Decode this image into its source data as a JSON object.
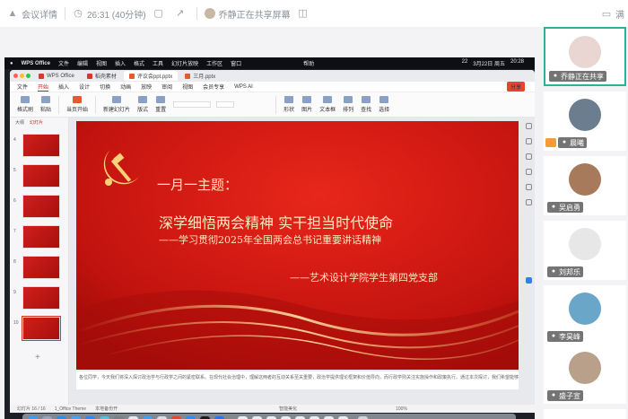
{
  "topbar": {
    "meeting_details": "会议详情",
    "timer": "26:31 (40分钟)",
    "sharing_status": "乔静正在共享屏幕",
    "right_label": "满"
  },
  "mac": {
    "menubar": [
      "WPS Office",
      "文件",
      "编辑",
      "视图",
      "插入",
      "格式",
      "工具",
      "幻灯片放映",
      "工作区",
      "窗口",
      "帮助"
    ],
    "status_right": [
      "22",
      "3月22日 周五",
      "20:28"
    ]
  },
  "wps": {
    "tabs": [
      {
        "label": "WPS Office",
        "color": "#d63a2b"
      },
      {
        "label": "稻壳素材",
        "color": "#d63a2b"
      },
      {
        "label": "评议会ppt.pptx",
        "color": "#e55b2d"
      },
      {
        "label": "三月.pptx",
        "color": "#e55b2d"
      }
    ],
    "menu": [
      "文件",
      "开始",
      "插入",
      "设计",
      "切换",
      "动画",
      "放映",
      "审阅",
      "视图",
      "会员专享",
      "WPS AI"
    ],
    "share_label": "分享",
    "ribbon": [
      "格式刷",
      "粘贴",
      "当页开始",
      "新建幻灯片",
      "版式",
      "重置",
      "形状",
      "图片",
      "文本框",
      "排列",
      "查找",
      "选择"
    ],
    "panel_tabs": [
      "大纲",
      "幻灯片"
    ],
    "slide_numbers": [
      "4",
      "5",
      "6",
      "7",
      "8",
      "9",
      "10"
    ],
    "notes_text": "各位同学，今天我们将深入探讨政治学与行政学之间的紧密联系。在现代社会治理中，理解这两者的互动关系至关重要，政治学提供理论框架和价值导向，而行政学则关注实施操作和政策执行。通过本次探讨，我们希望能够建立更加系统化的知识体系。",
    "status": [
      "幻灯片 16 / 16",
      "1_Office Theme",
      "本地备份开",
      "智能美化",
      "100%"
    ]
  },
  "slide": {
    "heading": "一月一主题：",
    "main_title": "深学细悟两会精神  实干担当时代使命",
    "subtitle": "——学习贯彻2025年全国两会总书记重要讲话精神",
    "organization": "——艺术设计学院学生第四党支部"
  },
  "participants": [
    {
      "name": "乔静正在共享",
      "speaking": true,
      "host": false,
      "avatar_color": "#e9d6d2"
    },
    {
      "name": "晨曦",
      "speaking": false,
      "host": true,
      "avatar_color": "#6a7e8f"
    },
    {
      "name": "吴启勇",
      "speaking": false,
      "host": false,
      "avatar_color": "#a87a5c"
    },
    {
      "name": "刘邦乐",
      "speaking": false,
      "host": false,
      "avatar_color": "#e7e7e7"
    },
    {
      "name": "李昊峰",
      "speaking": false,
      "host": false,
      "avatar_color": "#6aa6c8"
    },
    {
      "name": "盛子宣",
      "speaking": false,
      "host": false,
      "avatar_color": "#b9a08a"
    }
  ],
  "colors": {
    "accent": "#2bb29a",
    "slide_red": "#c9140f",
    "gold": "#f6d27a"
  }
}
